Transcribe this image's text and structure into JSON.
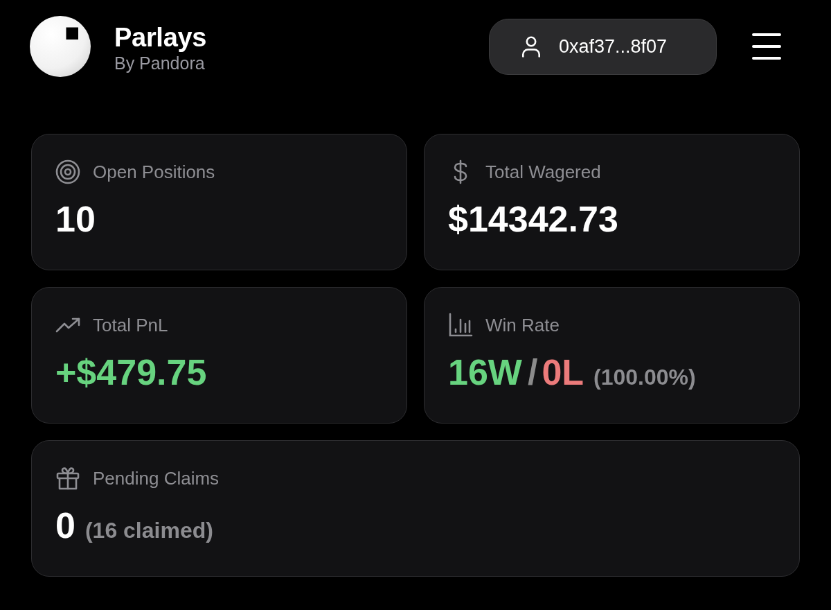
{
  "header": {
    "title": "Parlays",
    "subtitle": "By Pandora"
  },
  "wallet_button": {
    "label": "0xaf37...8f07"
  },
  "stats": [
    {
      "kind": "amount",
      "label": "Open Positions",
      "value": "10"
    },
    {
      "kind": "amount",
      "label": "Total Wagered",
      "value": "$14342.73"
    },
    {
      "kind": "amount",
      "label": "Total PnL",
      "value": "+$479.75",
      "positive": true
    },
    {
      "kind": "record",
      "label": "Win Rate",
      "wins": "16W",
      "separator": "/",
      "losses": "0L",
      "note": "(100.00%)"
    },
    {
      "kind": "amount",
      "label": "Pending Claims",
      "value": "0",
      "note": "(16 claimed)"
    }
  ]
}
